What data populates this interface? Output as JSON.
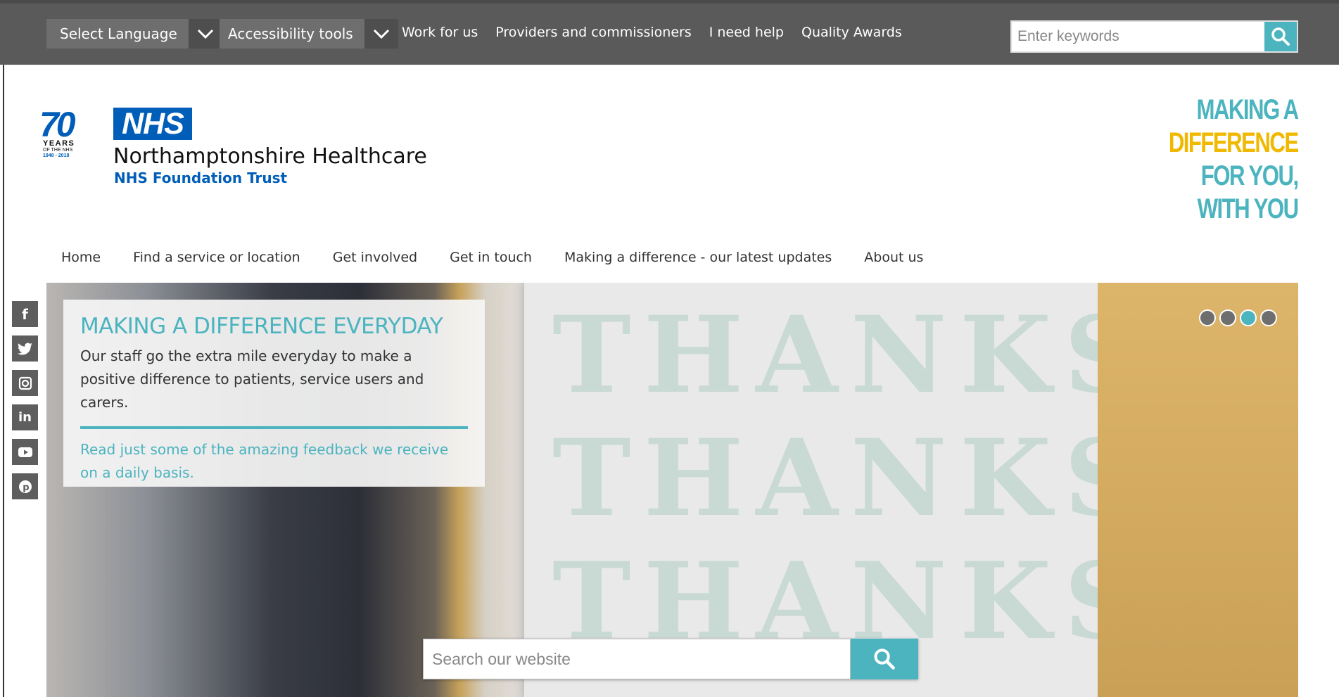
{
  "topbar": {
    "language_label": "Select Language",
    "accessibility_label": "Accessibility tools",
    "links": [
      "Work for us",
      "Providers and commissioners",
      "I need help",
      "Quality Awards"
    ],
    "search_placeholder": "Enter keywords"
  },
  "header": {
    "badge": {
      "number": "70",
      "line1": "YEARS",
      "line2": "OF THE NHS",
      "line3": "1948 - 2018"
    },
    "nhs_logo": "NHS",
    "org_name": "Northamptonshire Healthcare",
    "org_sub": "NHS Foundation Trust",
    "slogan": [
      "MAKING A",
      "DIFFERENCE",
      "FOR YOU,",
      "WITH YOU"
    ]
  },
  "main_nav": [
    "Home",
    "Find a service or location",
    "Get involved",
    "Get in touch",
    "Making a difference - our latest updates",
    "About us"
  ],
  "hero": {
    "title": "MAKING A DIFFERENCE EVERYDAY",
    "text": "Our staff go the extra mile everyday to make a positive difference to patients, service users and carers.",
    "link": "Read just some of the amazing feedback we receive on a daily basis.",
    "card_word": "THANKS",
    "slides": 4,
    "active_slide": 3
  },
  "site_search": {
    "placeholder": "Search our website"
  },
  "social": [
    "facebook-icon",
    "twitter-icon",
    "instagram-icon",
    "linkedin-icon",
    "youtube-icon",
    "pinterest-icon"
  ],
  "colors": {
    "accent": "#4bb4bf",
    "nhs_blue": "#005eb8",
    "slogan_yellow": "#f1b800",
    "topbar": "#5a5a5a"
  }
}
